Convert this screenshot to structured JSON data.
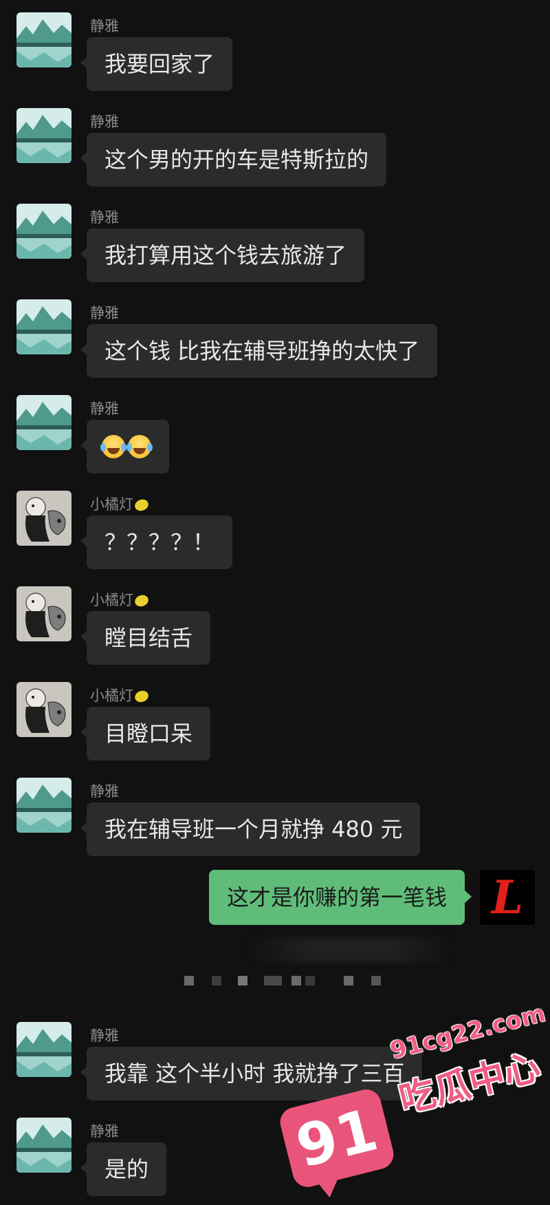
{
  "messages": [
    {
      "sender": "静雅",
      "text": "我要回家了",
      "avatar": "lake-avatar"
    },
    {
      "sender": "静雅",
      "text": "这个男的开的车是特斯拉的",
      "avatar": "lake-avatar"
    },
    {
      "sender": "静雅",
      "text": "我打算用这个钱去旅游了",
      "avatar": "lake-avatar"
    },
    {
      "sender": "静雅",
      "text": "这个钱 比我在辅导班挣的太快了",
      "avatar": "lake-avatar"
    },
    {
      "sender": "静雅",
      "text": "",
      "emoji": "laughing-tears-icon x2",
      "avatar": "lake-avatar"
    },
    {
      "sender": "小橘灯",
      "text": "？？？？！",
      "avatar": "sketch-avatar"
    },
    {
      "sender": "小橘灯",
      "text": "瞠目结舌",
      "avatar": "sketch-avatar"
    },
    {
      "sender": "小橘灯",
      "text": "目瞪口呆",
      "avatar": "sketch-avatar"
    },
    {
      "sender": "静雅",
      "text": "我在辅导班一个月就挣 480 元",
      "avatar": "lake-avatar"
    },
    {
      "sender": "静雅",
      "text": "我靠 这个半小时 我就挣了三百",
      "avatar": "lake-avatar"
    },
    {
      "sender": "静雅",
      "text": "是的",
      "avatar": "lake-avatar"
    }
  ],
  "outgoing": {
    "text": "这才是你赚的第一笔钱",
    "avatar_letter": "L",
    "avatar": "red-gothic-l-avatar"
  },
  "watermark": {
    "badge": "91",
    "url": "91cg22.com",
    "name": "吃瓜中心"
  },
  "colors": {
    "background": "#111111",
    "incoming_bubble": "#2b2b2b",
    "outgoing_bubble": "#5fbd79",
    "sender_name": "#8a8a8a",
    "watermark_pink": "#e9557a"
  }
}
